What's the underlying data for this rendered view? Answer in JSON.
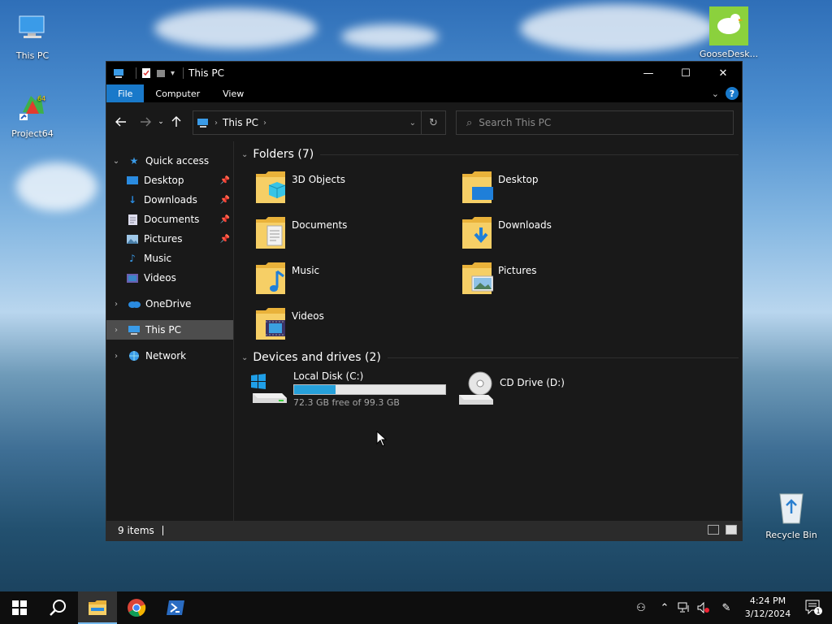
{
  "desktop": {
    "icons": [
      {
        "label": "This PC"
      },
      {
        "label": "Project64"
      },
      {
        "label": "GooseDesk..."
      },
      {
        "label": "Recycle Bin"
      }
    ]
  },
  "window": {
    "title": "This PC",
    "controls": {
      "minimize": "—",
      "maximize": "☐",
      "close": "✕"
    },
    "ribbon_tabs": [
      {
        "label": "File"
      },
      {
        "label": "Computer"
      },
      {
        "label": "View"
      }
    ],
    "help_label": "?",
    "address": {
      "path": "This PC"
    },
    "search": {
      "placeholder": "Search This PC"
    },
    "sidebar": {
      "quick_access": "Quick access",
      "quick_items": [
        {
          "label": "Desktop"
        },
        {
          "label": "Downloads"
        },
        {
          "label": "Documents"
        },
        {
          "label": "Pictures"
        },
        {
          "label": "Music"
        },
        {
          "label": "Videos"
        }
      ],
      "onedrive": "OneDrive",
      "this_pc": "This PC",
      "network": "Network"
    },
    "folders_header": "Folders (7)",
    "folders": [
      {
        "label": "3D Objects"
      },
      {
        "label": "Desktop"
      },
      {
        "label": "Documents"
      },
      {
        "label": "Downloads"
      },
      {
        "label": "Music"
      },
      {
        "label": "Pictures"
      },
      {
        "label": "Videos"
      }
    ],
    "drives_header": "Devices and drives (2)",
    "drives": [
      {
        "name": "Local Disk (C:)",
        "free_text": "72.3 GB free of 99.3 GB",
        "used_fraction": 0.272
      },
      {
        "name": "CD Drive (D:)"
      }
    ],
    "status": {
      "item_count": "9 items"
    }
  },
  "taskbar": {
    "clock_time": "4:24 PM",
    "clock_date": "3/12/2024",
    "notification_count": "1"
  },
  "colors": {
    "accent": "#1979ca",
    "progress": "#26a0da",
    "folder": "#f3c64c"
  }
}
